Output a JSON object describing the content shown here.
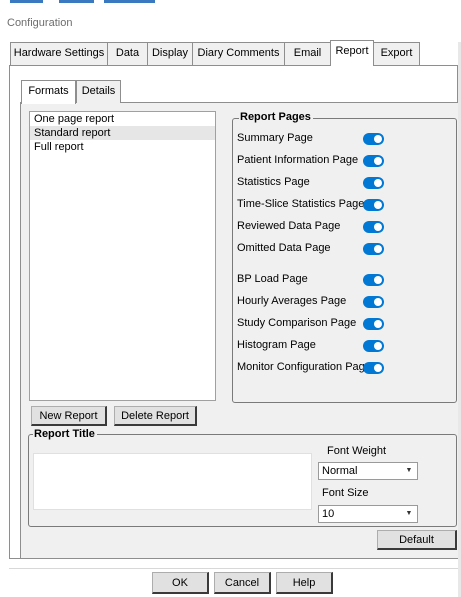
{
  "window": {
    "title": "Configuration"
  },
  "tabs": [
    {
      "label": "Hardware Settings"
    },
    {
      "label": "Data"
    },
    {
      "label": "Display"
    },
    {
      "label": "Diary Comments"
    },
    {
      "label": "Email"
    },
    {
      "label": "Report",
      "active": true
    },
    {
      "label": "Export"
    }
  ],
  "subtabs": [
    {
      "label": "Formats",
      "active": true
    },
    {
      "label": "Details"
    }
  ],
  "formats_list": {
    "items": [
      {
        "label": "One page report"
      },
      {
        "label": "Standard report",
        "selected": true
      },
      {
        "label": "Full report"
      }
    ]
  },
  "report_pages": {
    "legend": "Report Pages",
    "items": [
      {
        "label": "Summary Page",
        "enabled": true
      },
      {
        "label": "Patient Information Page",
        "enabled": true
      },
      {
        "label": "Statistics Page",
        "enabled": true
      },
      {
        "label": "Time-Slice Statistics Page",
        "enabled": true
      },
      {
        "label": "Reviewed Data Page",
        "enabled": true
      },
      {
        "label": "Omitted Data Page",
        "enabled": true
      },
      {
        "label": "BP Load Page",
        "enabled": true
      },
      {
        "label": "Hourly Averages Page",
        "enabled": true
      },
      {
        "label": "Study Comparison Page",
        "enabled": true
      },
      {
        "label": "Histogram Page",
        "enabled": true
      },
      {
        "label": "Monitor Configuration Page",
        "enabled": true
      }
    ]
  },
  "buttons": {
    "new_report": "New Report",
    "delete_report": "Delete Report",
    "default": "Default",
    "ok": "OK",
    "cancel": "Cancel",
    "help": "Help"
  },
  "report_title": {
    "legend": "Report Title",
    "text": "",
    "font_weight_label": "Font Weight",
    "font_weight_value": "Normal",
    "font_size_label": "Font Size",
    "font_size_value": "10"
  },
  "colors": {
    "toggle_on": "#0078d4",
    "panel_bg": "#f0f0f0"
  }
}
